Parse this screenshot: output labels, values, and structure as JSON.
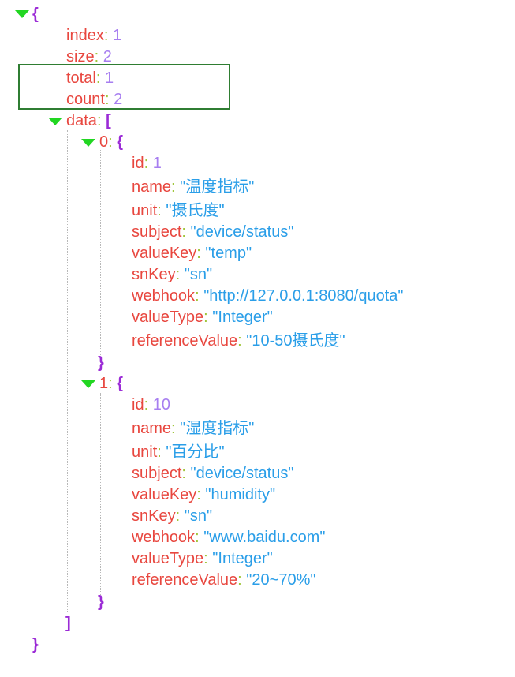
{
  "json": {
    "root_open": "{",
    "root_close": "}",
    "fields": [
      {
        "key": "index",
        "value": "1"
      },
      {
        "key": "size",
        "value": "2"
      },
      {
        "key": "total",
        "value": "1"
      },
      {
        "key": "count",
        "value": "2"
      }
    ],
    "data_key": "data",
    "array_open": "[",
    "array_close": "]",
    "colon": ":",
    "items": [
      {
        "index": "0",
        "open": "{",
        "close": "}",
        "fields": [
          {
            "key": "id",
            "value": "1",
            "type": "number"
          },
          {
            "key": "name",
            "value": "\"温度指标\"",
            "type": "string"
          },
          {
            "key": "unit",
            "value": "\"摄氏度\"",
            "type": "string"
          },
          {
            "key": "subject",
            "value": "\"device/status\"",
            "type": "string"
          },
          {
            "key": "valueKey",
            "value": "\"temp\"",
            "type": "string"
          },
          {
            "key": "snKey",
            "value": "\"sn\"",
            "type": "string"
          },
          {
            "key": "webhook",
            "value": "\"http://127.0.0.1:8080/quota\"",
            "type": "string"
          },
          {
            "key": "valueType",
            "value": "\"Integer\"",
            "type": "string"
          },
          {
            "key": "referenceValue",
            "value": "\"10-50摄氏度\"",
            "type": "string"
          }
        ]
      },
      {
        "index": "1",
        "open": "{",
        "close": "}",
        "fields": [
          {
            "key": "id",
            "value": "10",
            "type": "number"
          },
          {
            "key": "name",
            "value": "\"湿度指标\"",
            "type": "string"
          },
          {
            "key": "unit",
            "value": "\"百分比\"",
            "type": "string"
          },
          {
            "key": "subject",
            "value": "\"device/status\"",
            "type": "string"
          },
          {
            "key": "valueKey",
            "value": "\"humidity\"",
            "type": "string"
          },
          {
            "key": "snKey",
            "value": "\"sn\"",
            "type": "string"
          },
          {
            "key": "webhook",
            "value": "\"www.baidu.com\"",
            "type": "string"
          },
          {
            "key": "valueType",
            "value": "\"Integer\"",
            "type": "string"
          },
          {
            "key": "referenceValue",
            "value": "\"20~70%\"",
            "type": "string"
          }
        ]
      }
    ]
  },
  "colors": {
    "key": "#e8473f",
    "colon": "#a0c63b",
    "number": "#a77ef0",
    "string": "#2a9ee8",
    "brace": "#9b2bd6",
    "toggle": "#22d622",
    "highlight": "#2f7d32"
  },
  "icons": {
    "toggle": "caret-down-icon"
  }
}
